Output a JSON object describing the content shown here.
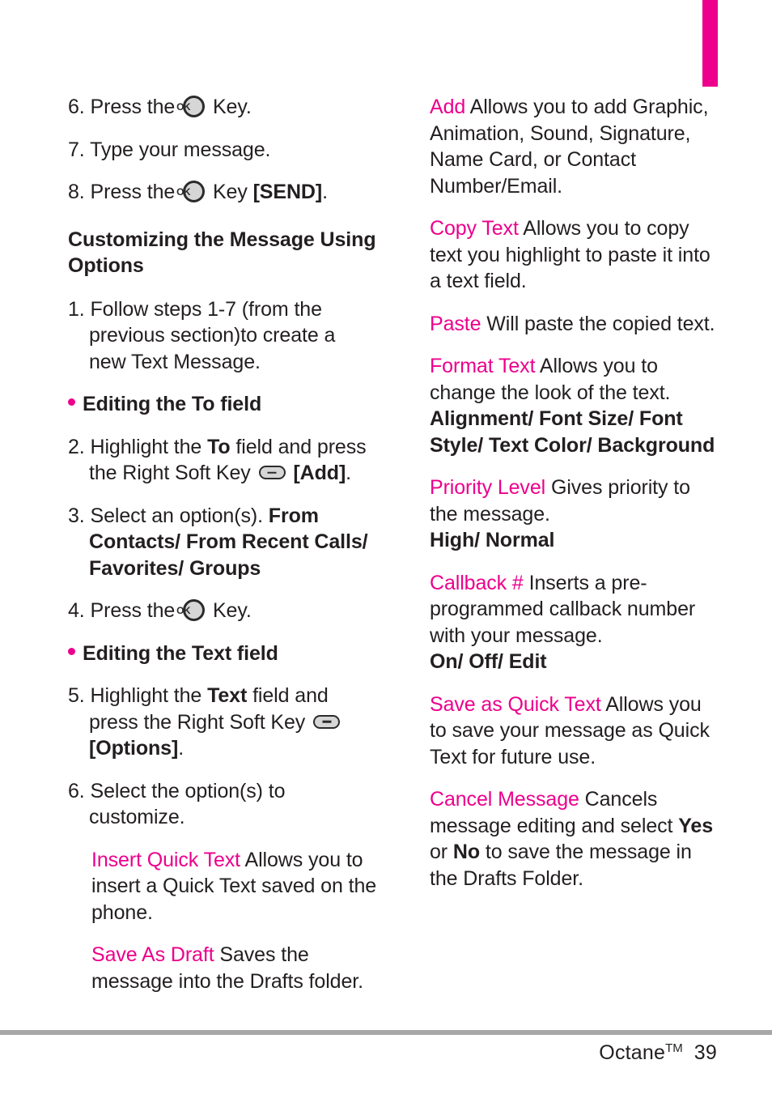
{
  "theme": {
    "accent_pink": "#EC008C",
    "text_color": "#231F20",
    "rule_gray": "#A7A7A7",
    "key_fill": "#D6D6D6"
  },
  "icons": {
    "ok_key_label": "OK",
    "ok_key_name": "ok-key-icon",
    "soft_key_name": "soft-key-icon"
  },
  "left_column": {
    "steps_top": [
      {
        "num": "6.",
        "pre": "Press the",
        "icon": "ok-key",
        "post": "Key."
      },
      {
        "num": "7.",
        "pre": "Type your message.",
        "icon": null,
        "post": ""
      },
      {
        "num": "8.",
        "pre": "Press the",
        "icon": "ok-key",
        "post": "Key",
        "bold_tail": "[SEND]",
        "tail": "."
      }
    ],
    "section_heading": "Customizing the Message Using Options",
    "step1": {
      "num": "1.",
      "text": "Follow steps 1-7 (from the previous section)to create a new Text Message."
    },
    "bullet_to_field": "Editing the To field",
    "step2": {
      "num": "2.",
      "a": "Highlight the",
      "b": "To",
      "c": "field and press the Right Soft Key",
      "d": "[Add]",
      "e": "."
    },
    "step3": {
      "num": "3.",
      "text": "Select an option(s).",
      "options": "From Contacts/ From Recent Calls/ Favorites/ Groups"
    },
    "step4": {
      "num": "4.",
      "pre": "Press the",
      "post": "Key."
    },
    "bullet_text_field": "Editing the Text field",
    "step5": {
      "num": "5.",
      "a": "Highlight the",
      "b": "Text",
      "c": "field and press the Right Soft Key",
      "d": "[Options]",
      "e": "."
    },
    "step6": {
      "num": "6.",
      "text": "Select the option(s) to customize."
    },
    "options": [
      {
        "term": "Insert Quick Text",
        "description": "Allows you to insert a Quick Text saved on the phone."
      },
      {
        "term": "Save As Draft",
        "description": "Saves the message into the Drafts folder."
      }
    ]
  },
  "right_column": {
    "options": [
      {
        "term": "Add",
        "description": "Allows you to add Graphic, Animation, Sound, Signature, Name Card, or Contact Number/Email.",
        "values": ""
      },
      {
        "term": "Copy Text",
        "description": "Allows you to copy text you highlight to paste it into a text field.",
        "values": ""
      },
      {
        "term": "Paste",
        "description": "Will paste the copied text.",
        "values": ""
      },
      {
        "term": "Format Text",
        "description": "Allows you to change the look of the text.",
        "values": "Alignment/ Font Size/ Font Style/ Text Color/ Background"
      },
      {
        "term": "Priority Level",
        "description": "Gives priority to the message.",
        "values": "High/ Normal"
      },
      {
        "term": "Callback #",
        "description": "Inserts a pre-programmed callback number with your message.",
        "values": "On/ Off/ Edit"
      },
      {
        "term": "Save as Quick Text",
        "description": "Allows you to save your message as Quick Text for future use.",
        "values": ""
      }
    ],
    "cancel_message": {
      "term": "Cancel Message",
      "a": "Cancels message editing and select",
      "b": "Yes",
      "c": "or",
      "d": "No",
      "e": "to save the message in the Drafts Folder."
    }
  },
  "footer": {
    "product": "Octane",
    "trademark": "TM",
    "page_number": "39"
  }
}
